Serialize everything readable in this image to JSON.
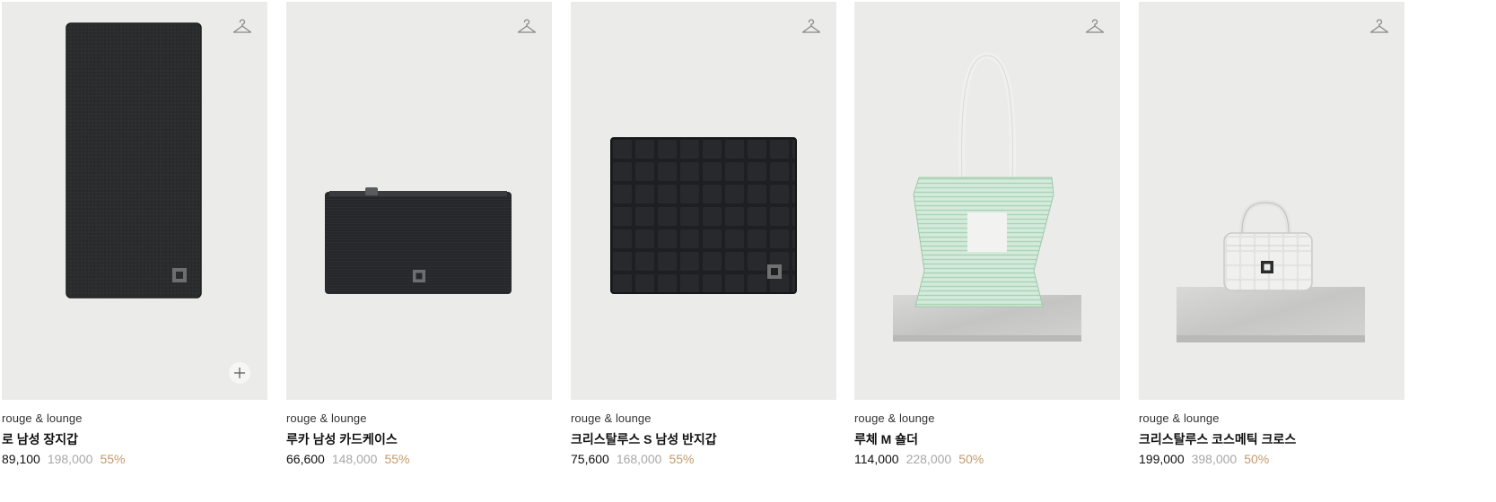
{
  "products": [
    {
      "brand": "rouge & lounge",
      "name": "로 남성 장지갑",
      "price": "89,100",
      "original_price": "198,000",
      "discount": "55%",
      "image": "black-long-wallet"
    },
    {
      "brand": "rouge & lounge",
      "name": "루카 남성 카드케이스",
      "price": "66,600",
      "original_price": "148,000",
      "discount": "55%",
      "image": "black-zip-card-case"
    },
    {
      "brand": "rouge & lounge",
      "name": "크리스탈루스 S 남성 반지갑",
      "price": "75,600",
      "original_price": "168,000",
      "discount": "55%",
      "image": "black-quilted-bifold-wallet"
    },
    {
      "brand": "rouge & lounge",
      "name": "루체 M 숄더",
      "price": "114,000",
      "original_price": "228,000",
      "discount": "50%",
      "image": "mint-striped-shoulder-bag"
    },
    {
      "brand": "rouge & lounge",
      "name": "크리스탈루스 코스메틱 크로스",
      "price": "199,000",
      "original_price": "398,000",
      "discount": "50%",
      "image": "white-quilted-cosmetic-bag"
    }
  ],
  "colors": {
    "card_bg": "#ebebe9",
    "price": "#111111",
    "original_price": "#a8a8a8",
    "discount": "#c49a6c"
  },
  "icons": {
    "wishlist": "hanger-icon",
    "quick_add": "plus-icon"
  }
}
